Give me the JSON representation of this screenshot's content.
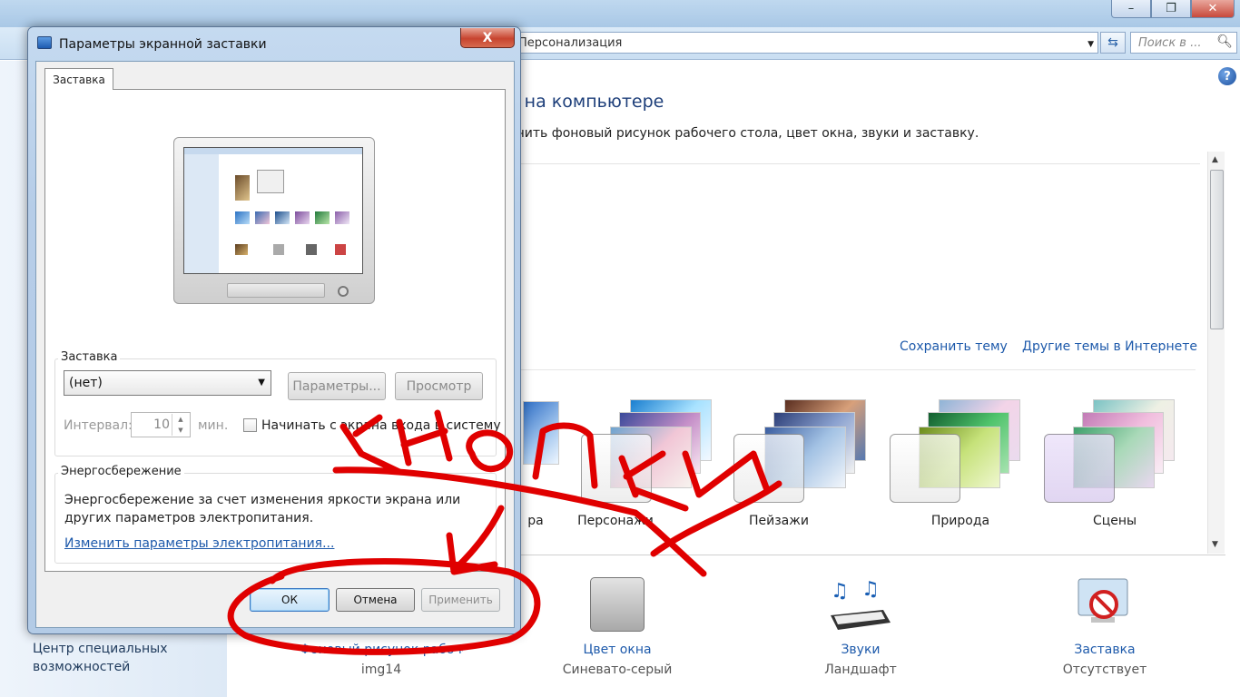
{
  "background_window": {
    "address_text": "Персонализация",
    "search_placeholder": "Поиск в ...",
    "heading": "а на компьютере",
    "description": "енить фоновый рисунок рабочего стола, цвет окна, звуки и заставку.",
    "save_theme": "Сохранить тему",
    "more_themes": "Другие темы в Интернете",
    "themes": [
      {
        "label": "ра"
      },
      {
        "label": "Персонажи"
      },
      {
        "label": "Пейзажи"
      },
      {
        "label": "Природа"
      },
      {
        "label": "Сцены"
      }
    ],
    "sidebar_link": "Центр специальных возможностей",
    "bottom_items": [
      {
        "title": "Фоновый рисунок рабочего стола",
        "subtitle": "img14"
      },
      {
        "title": "Цвет окна",
        "subtitle": "Синевато-серый"
      },
      {
        "title": "Звуки",
        "subtitle": "Ландшафт"
      },
      {
        "title": "Заставка",
        "subtitle": "Отсутствует"
      }
    ]
  },
  "dialog": {
    "title": "Параметры экранной заставки",
    "close_label": "X",
    "tab_label": "Заставка",
    "screensaver_group_label": "Заставка",
    "screensaver_value": "(нет)",
    "params_button": "Параметры...",
    "preview_button": "Просмотр",
    "interval_label": "Интервал:",
    "interval_value": "10",
    "interval_unit": "мин.",
    "logon_label": "Начинать с экрана входа в систему",
    "energy_group_label": "Энергосбережение",
    "energy_text": "Энергосбережение за счет изменения яркости экрана или других параметров электропитания.",
    "energy_link": "Изменить параметры электропитания...",
    "ok_button": "ОК",
    "cancel_button": "Отмена",
    "apply_button": "Применить"
  },
  "annotation": {
    "handwritten_text": "кнопки",
    "color": "#e00000"
  },
  "colors": {
    "link": "#1e5aab",
    "heading": "#1e3f7a",
    "dialog_frame": "#b6cde8"
  }
}
